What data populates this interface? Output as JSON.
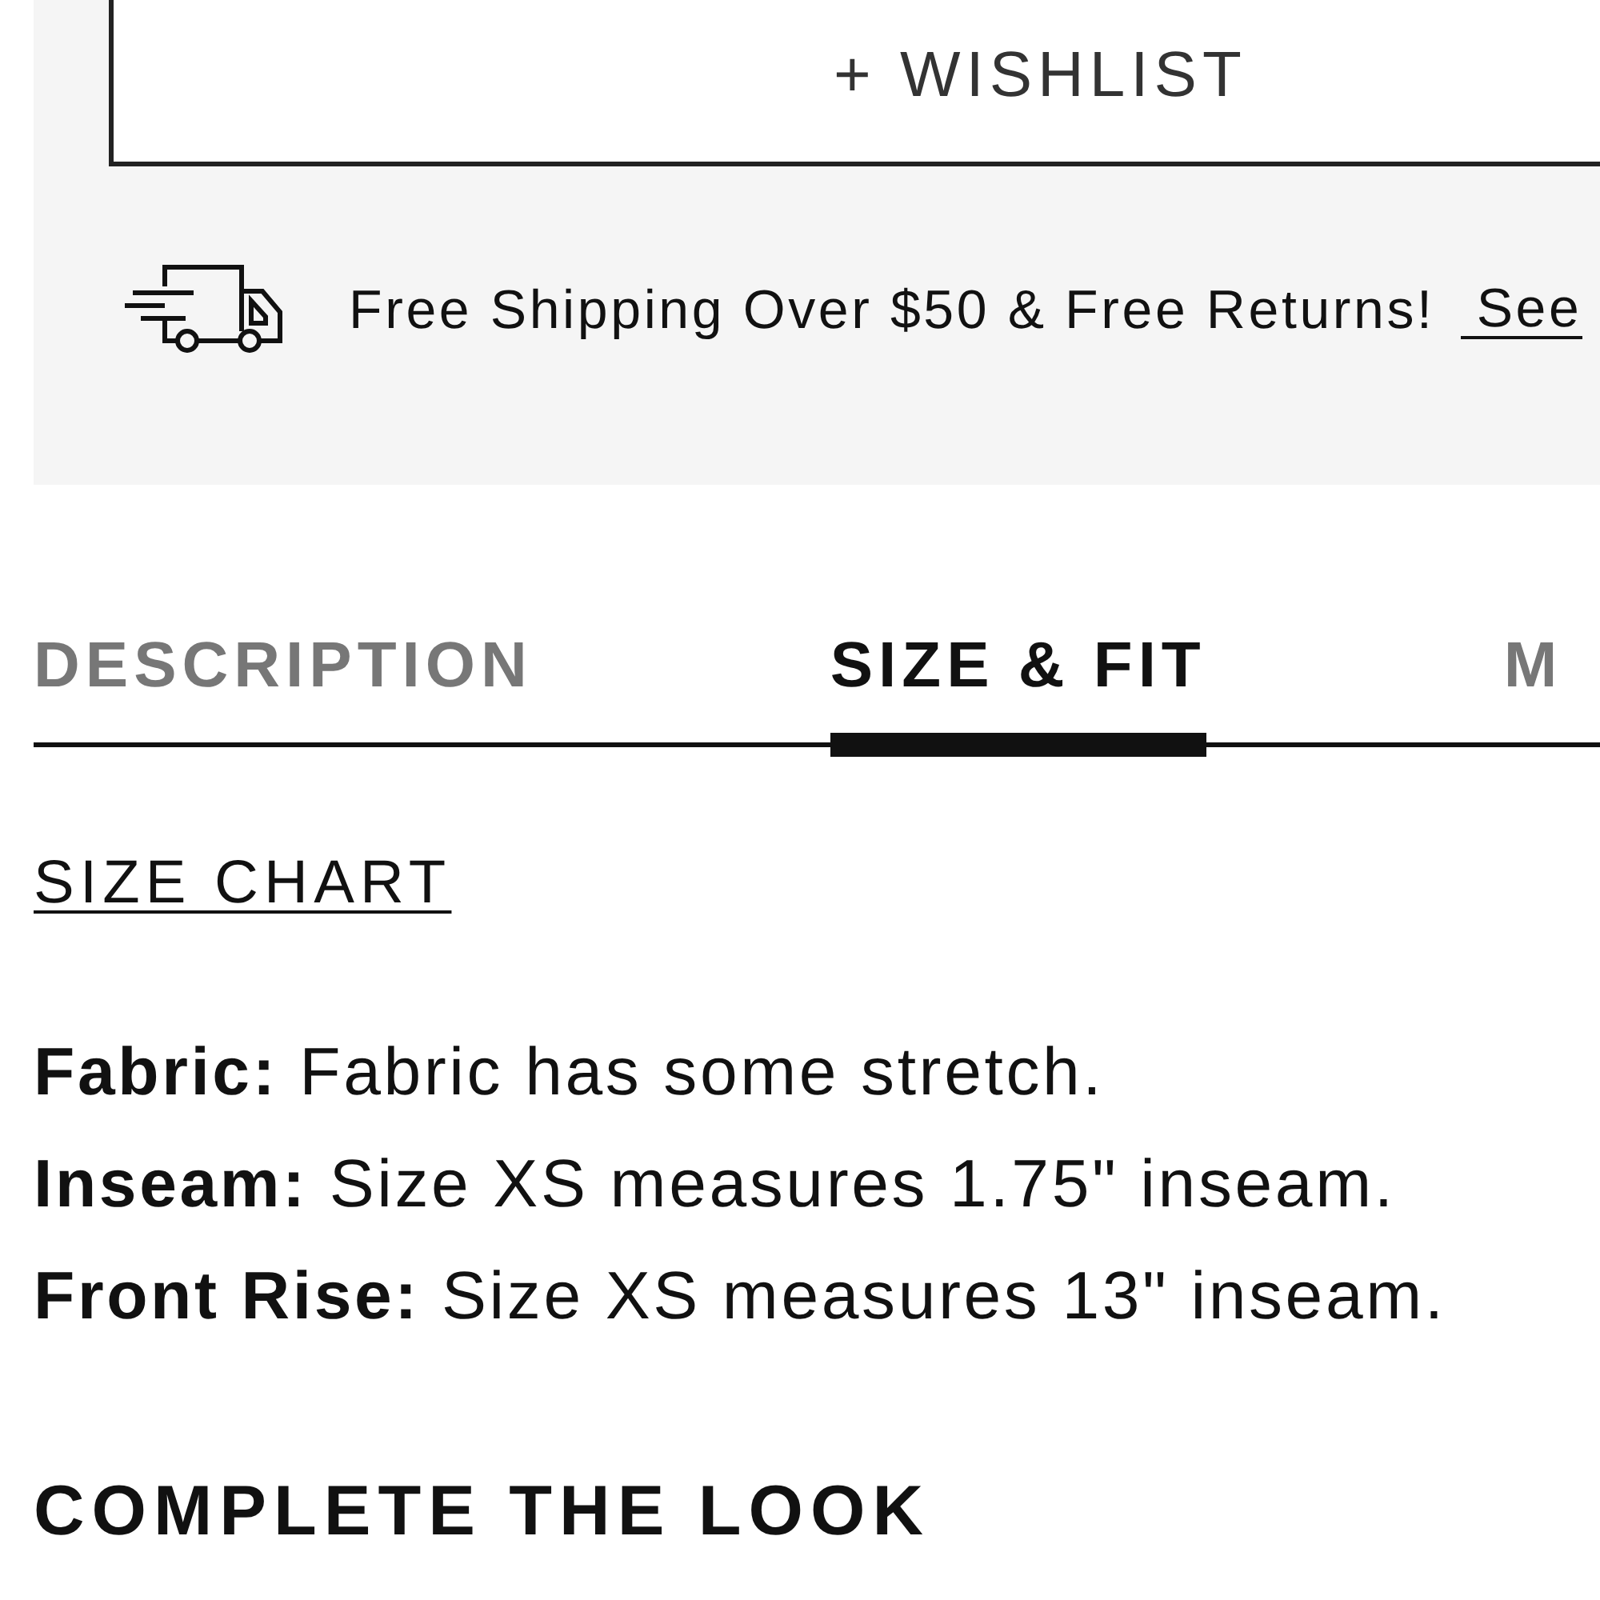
{
  "wishlist_button": {
    "label": "+ WISHLIST"
  },
  "shipping_banner": {
    "text": "Free Shipping Over $50 & Free Returns!",
    "link": "See"
  },
  "tabs": [
    {
      "label": "DESCRIPTION",
      "selected": false
    },
    {
      "label": "SIZE & FIT",
      "selected": true
    },
    {
      "label": "M",
      "selected": false
    }
  ],
  "size_chart_link": "SIZE CHART",
  "details": [
    "**Fabric:** Fabric has some stretch.",
    "**Inseam:** Size XS measures 1.75\" inseam.",
    "**Front Rise:** Size XS measures 13\" inseam."
  ],
  "section_heading": "COMPLETE THE LOOK"
}
